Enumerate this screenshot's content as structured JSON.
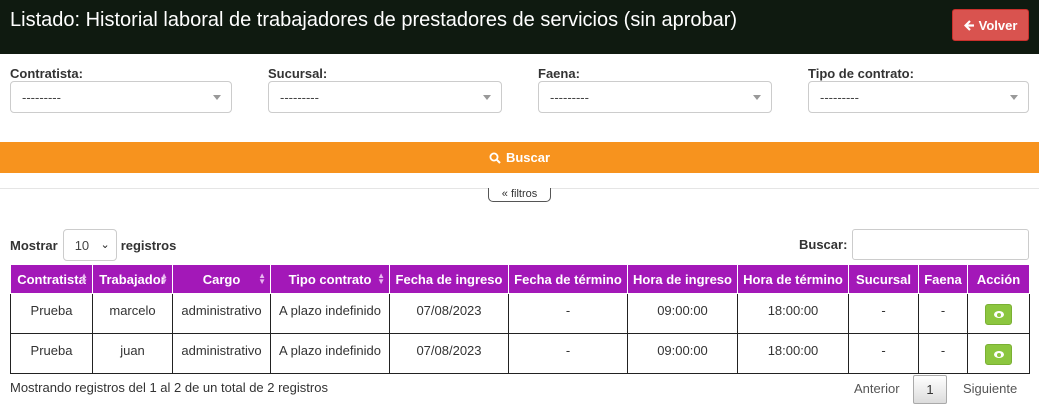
{
  "header": {
    "title": "Listado: Historial laboral de trabajadores de prestadores de servicios (sin aprobar)",
    "back_label": "Volver"
  },
  "filters": [
    {
      "label": "Contratista:",
      "value": "---------"
    },
    {
      "label": "Sucursal:",
      "value": "---------"
    },
    {
      "label": "Faena:",
      "value": "---------"
    },
    {
      "label": "Tipo de contrato:",
      "value": "---------"
    }
  ],
  "search_button": "Buscar",
  "filters_toggle": "filtros",
  "length": {
    "prefix": "Mostrar",
    "value": "10",
    "suffix": "registros"
  },
  "search": {
    "label": "Buscar:",
    "value": ""
  },
  "table": {
    "columns": [
      "Contratista",
      "Trabajador",
      "Cargo",
      "Tipo contrato",
      "Fecha de ingreso",
      "Fecha de término",
      "Hora de ingreso",
      "Hora de término",
      "Sucursal",
      "Faena",
      "Acción"
    ],
    "rows": [
      [
        "Prueba",
        "marcelo",
        "administrativo",
        "A plazo indefinido",
        "07/08/2023",
        "-",
        "09:00:00",
        "18:00:00",
        "-",
        "-"
      ],
      [
        "Prueba",
        "juan",
        "administrativo",
        "A plazo indefinido",
        "07/08/2023",
        "-",
        "09:00:00",
        "18:00:00",
        "-",
        "-"
      ]
    ]
  },
  "info": "Mostrando registros del 1 al 2 de un total de 2 registros",
  "pagination": {
    "prev": "Anterior",
    "current": "1",
    "next": "Siguiente"
  },
  "colors": {
    "header_bg": "#0f1a10",
    "back_button": "#d9534f",
    "search_button": "#f7931e",
    "table_header": "#a318b8",
    "action_button": "#8cc63f"
  }
}
